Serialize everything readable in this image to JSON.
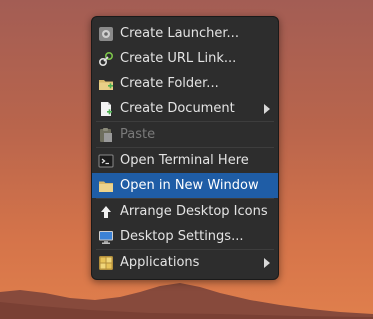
{
  "colors": {
    "menu_background": "#2d2d2d",
    "highlight": "#1f5da6",
    "text": "#e4e4e4",
    "disabled_text": "#7a7a7a"
  },
  "context_menu": {
    "items": [
      {
        "label": "Create Launcher...",
        "icon": "launcher-gear-icon"
      },
      {
        "label": "Create URL Link...",
        "icon": "link-icon"
      },
      {
        "label": "Create Folder...",
        "icon": "folder-add-icon"
      },
      {
        "label": "Create Document",
        "icon": "document-add-icon",
        "submenu": true
      },
      {
        "label": "Paste",
        "icon": "paste-icon",
        "disabled": true
      },
      {
        "label": "Open Terminal Here",
        "icon": "terminal-icon"
      },
      {
        "label": "Open in New Window",
        "icon": "folder-icon",
        "highlighted": true
      },
      {
        "label": "Arrange Desktop Icons",
        "icon": "arrange-up-icon"
      },
      {
        "label": "Desktop Settings...",
        "icon": "monitor-icon"
      },
      {
        "label": "Applications",
        "icon": "applications-icon",
        "submenu": true
      }
    ]
  }
}
